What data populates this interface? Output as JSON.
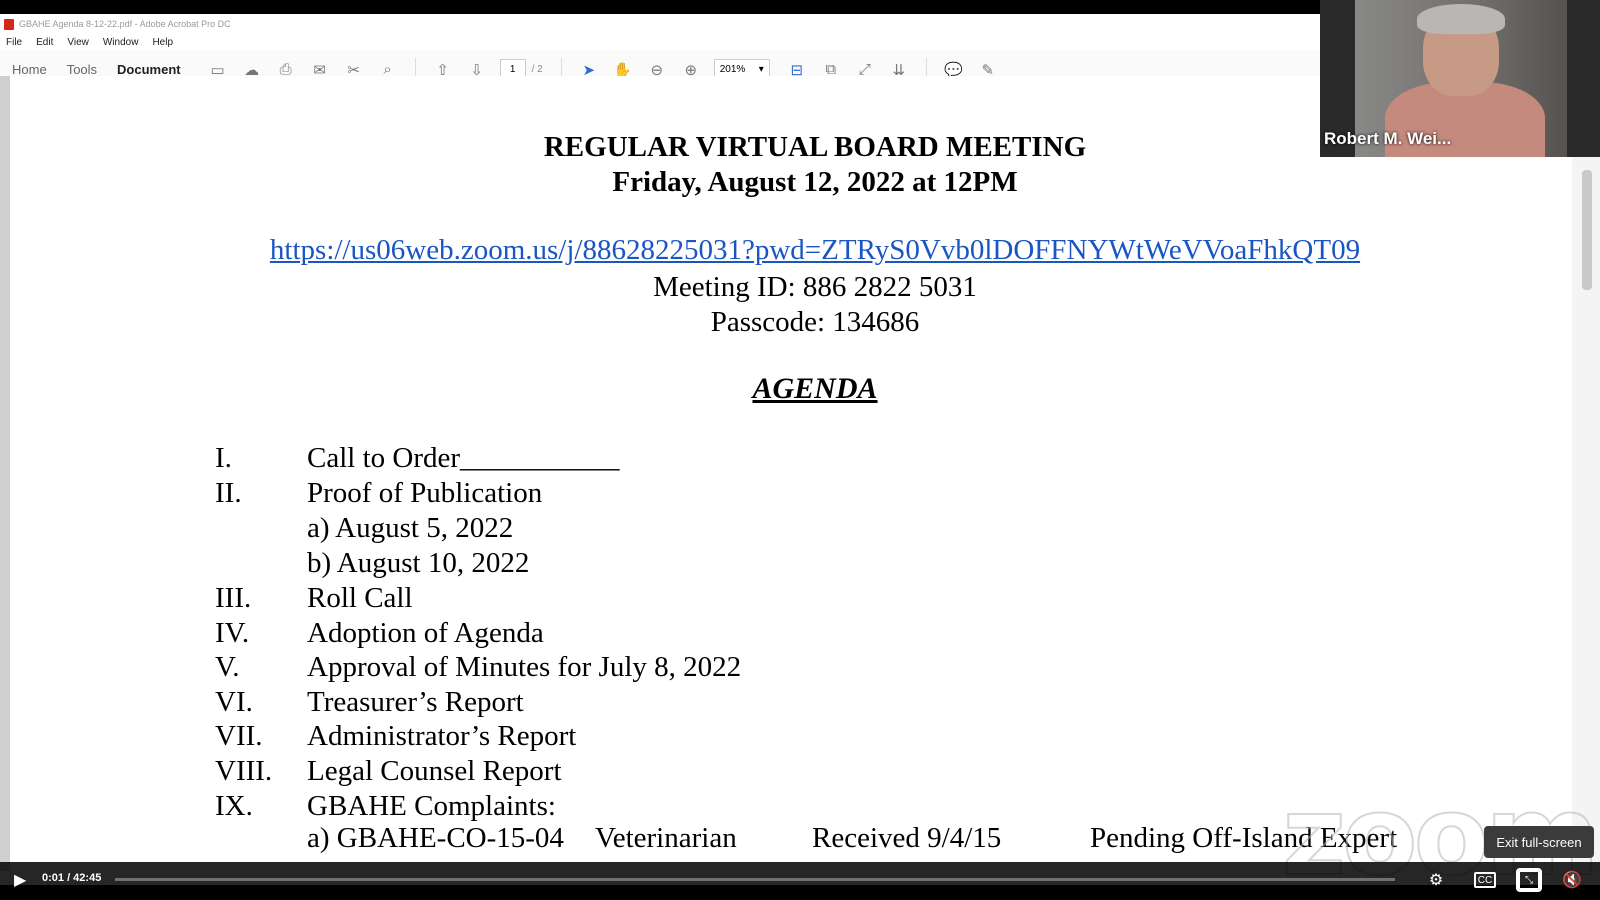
{
  "acrobat": {
    "title": "GBAHE Agenda 8-12-22.pdf - Adobe Acrobat Pro DC",
    "menu": [
      "File",
      "Edit",
      "View",
      "Window",
      "Help"
    ],
    "tabs": [
      "Home",
      "Tools",
      "Document"
    ],
    "page_current": "1",
    "page_total": "/ 2",
    "zoom": "201%"
  },
  "document": {
    "heading1": "REGULAR VIRTUAL BOARD MEETING",
    "heading2": "Friday, August 12, 2022 at 12PM",
    "link": "https://us06web.zoom.us/j/88628225031?pwd=ZTRyS0Vvb0lDOFFNYWtWeVVoaFhkQT09",
    "meeting_id": "Meeting ID: 886 2822 5031",
    "passcode": "Passcode: 134686",
    "agenda_title": "AGENDA",
    "items": [
      {
        "num": "I.",
        "text": "Call to Order___________"
      },
      {
        "num": "II.",
        "text": "Proof of Publication"
      },
      {
        "num": "",
        "text": "a)   August 5, 2022"
      },
      {
        "num": "",
        "text": "b)   August 10, 2022"
      },
      {
        "num": "III.",
        "text": "Roll Call"
      },
      {
        "num": "IV.",
        "text": "Adoption of Agenda"
      },
      {
        "num": "V.",
        "text": "Approval of Minutes for July 8, 2022"
      },
      {
        "num": "VI.",
        "text": "Treasurer’s Report"
      },
      {
        "num": "VII.",
        "text": "Administrator’s Report"
      },
      {
        "num": "VIII.",
        "text": "Legal Counsel Report"
      },
      {
        "num": "IX.",
        "text": "GBAHE Complaints:"
      }
    ],
    "complaint_a": {
      "label": "a)   GBAHE-CO-15-04",
      "type": "Veterinarian",
      "received": "Received 9/4/15",
      "status": "Pending Off-Island Expert"
    }
  },
  "participant": {
    "name": "Robert M. Wei..."
  },
  "player": {
    "time": "0:01 / 42:45",
    "tooltip": "Exit full-screen",
    "watermark": "zoom"
  }
}
